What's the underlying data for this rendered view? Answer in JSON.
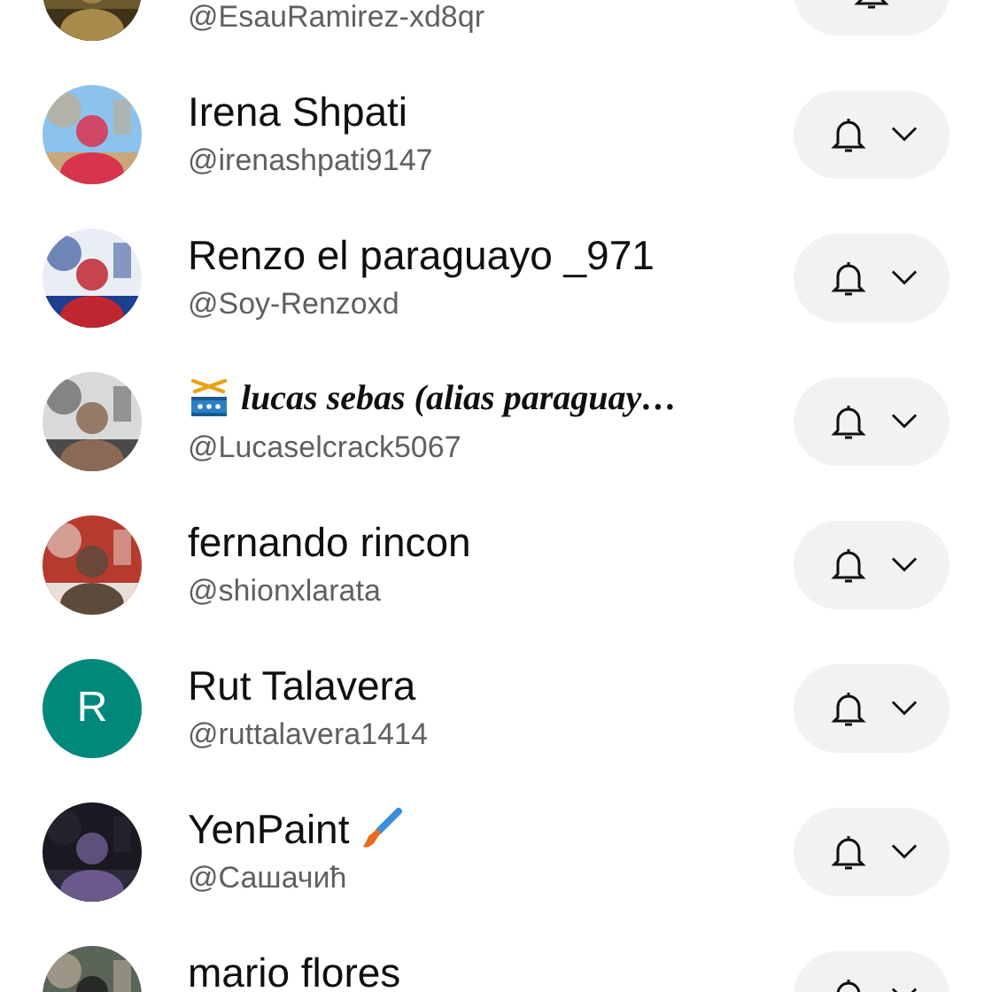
{
  "channels": [
    {
      "kind": "plain",
      "handle": "@EsauRamirez-xd8qr"
    },
    {
      "kind": "plain",
      "name": "Irena Shpati",
      "handle": "@irenashpati9147"
    },
    {
      "kind": "plain",
      "name": "Renzo el paraguayo _971",
      "handle": "@Soy-Renzoxd"
    },
    {
      "kind": "decorated",
      "name": "lucas sebas (alias paraguay…",
      "handle": "@Lucaselcrack5067"
    },
    {
      "kind": "plain",
      "name": "fernando rincon",
      "handle": "@shionxlarata"
    },
    {
      "kind": "plain",
      "name": "Rut Talavera",
      "handle": "@ruttalavera1414",
      "avatar": {
        "kind": "letter",
        "letter": "R",
        "color": "#00897b"
      }
    },
    {
      "kind": "emoji",
      "name": "YenPaint",
      "handle": "@Сашачић"
    },
    {
      "kind": "plain",
      "name": "mario flores"
    }
  ]
}
